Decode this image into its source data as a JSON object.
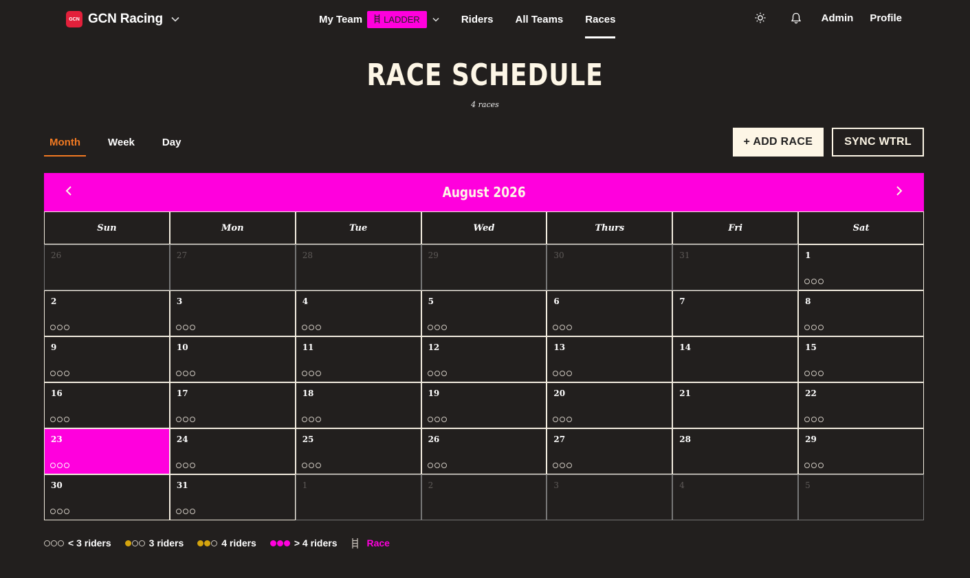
{
  "nav": {
    "brand": "GCN Racing",
    "logo_text": "GCN",
    "my_team": "My Team",
    "ladder_badge": "LADDER",
    "links": [
      "Riders",
      "All Teams",
      "Races"
    ],
    "admin": "Admin",
    "profile": "Profile"
  },
  "header": {
    "title": "RACE SCHEDULE",
    "subtitle": "4 races"
  },
  "views": [
    "Month",
    "Week",
    "Day"
  ],
  "actions": {
    "add_race": "+ ADD RACE",
    "sync": "SYNC WTRL"
  },
  "calendar": {
    "month_label": "August 2026",
    "weekdays": [
      "Sun",
      "Mon",
      "Tue",
      "Wed",
      "Thurs",
      "Fri",
      "Sat"
    ],
    "today": 23,
    "cells": [
      {
        "day": "26",
        "other": true,
        "dots": false
      },
      {
        "day": "27",
        "other": true,
        "dots": false
      },
      {
        "day": "28",
        "other": true,
        "dots": false
      },
      {
        "day": "29",
        "other": true,
        "dots": false
      },
      {
        "day": "30",
        "other": true,
        "dots": false
      },
      {
        "day": "31",
        "other": true,
        "dots": false
      },
      {
        "day": "1",
        "other": false,
        "dots": true
      },
      {
        "day": "2",
        "other": false,
        "dots": true
      },
      {
        "day": "3",
        "other": false,
        "dots": true
      },
      {
        "day": "4",
        "other": false,
        "dots": true
      },
      {
        "day": "5",
        "other": false,
        "dots": true
      },
      {
        "day": "6",
        "other": false,
        "dots": true
      },
      {
        "day": "7",
        "other": false,
        "dots": false
      },
      {
        "day": "8",
        "other": false,
        "dots": true
      },
      {
        "day": "9",
        "other": false,
        "dots": true
      },
      {
        "day": "10",
        "other": false,
        "dots": true
      },
      {
        "day": "11",
        "other": false,
        "dots": true
      },
      {
        "day": "12",
        "other": false,
        "dots": true
      },
      {
        "day": "13",
        "other": false,
        "dots": true
      },
      {
        "day": "14",
        "other": false,
        "dots": false
      },
      {
        "day": "15",
        "other": false,
        "dots": true
      },
      {
        "day": "16",
        "other": false,
        "dots": true
      },
      {
        "day": "17",
        "other": false,
        "dots": true
      },
      {
        "day": "18",
        "other": false,
        "dots": true
      },
      {
        "day": "19",
        "other": false,
        "dots": true
      },
      {
        "day": "20",
        "other": false,
        "dots": true
      },
      {
        "day": "21",
        "other": false,
        "dots": false
      },
      {
        "day": "22",
        "other": false,
        "dots": true
      },
      {
        "day": "23",
        "other": false,
        "dots": true,
        "today": true
      },
      {
        "day": "24",
        "other": false,
        "dots": true
      },
      {
        "day": "25",
        "other": false,
        "dots": true
      },
      {
        "day": "26",
        "other": false,
        "dots": true
      },
      {
        "day": "27",
        "other": false,
        "dots": true
      },
      {
        "day": "28",
        "other": false,
        "dots": false
      },
      {
        "day": "29",
        "other": false,
        "dots": true
      },
      {
        "day": "30",
        "other": false,
        "dots": true
      },
      {
        "day": "31",
        "other": false,
        "dots": true
      },
      {
        "day": "1",
        "other": true,
        "dots": false
      },
      {
        "day": "2",
        "other": true,
        "dots": false
      },
      {
        "day": "3",
        "other": true,
        "dots": false
      },
      {
        "day": "4",
        "other": true,
        "dots": false
      },
      {
        "day": "5",
        "other": true,
        "dots": false
      }
    ]
  },
  "legend": {
    "lt3": "< 3 riders",
    "eq3": "3 riders",
    "eq4": "4 riders",
    "gt4": "> 4 riders",
    "race": "Race"
  },
  "colors": {
    "accent": "#ff00dd",
    "active_tab": "#f27a22",
    "gold": "#d4a40e",
    "background": "#221f1e",
    "cream": "#fdf6e6"
  },
  "icons": {
    "theme": "sun-icon",
    "notifications": "bell-icon",
    "ladder": "ladder-icon",
    "prev": "chevron-left-icon",
    "next": "chevron-right-icon"
  }
}
